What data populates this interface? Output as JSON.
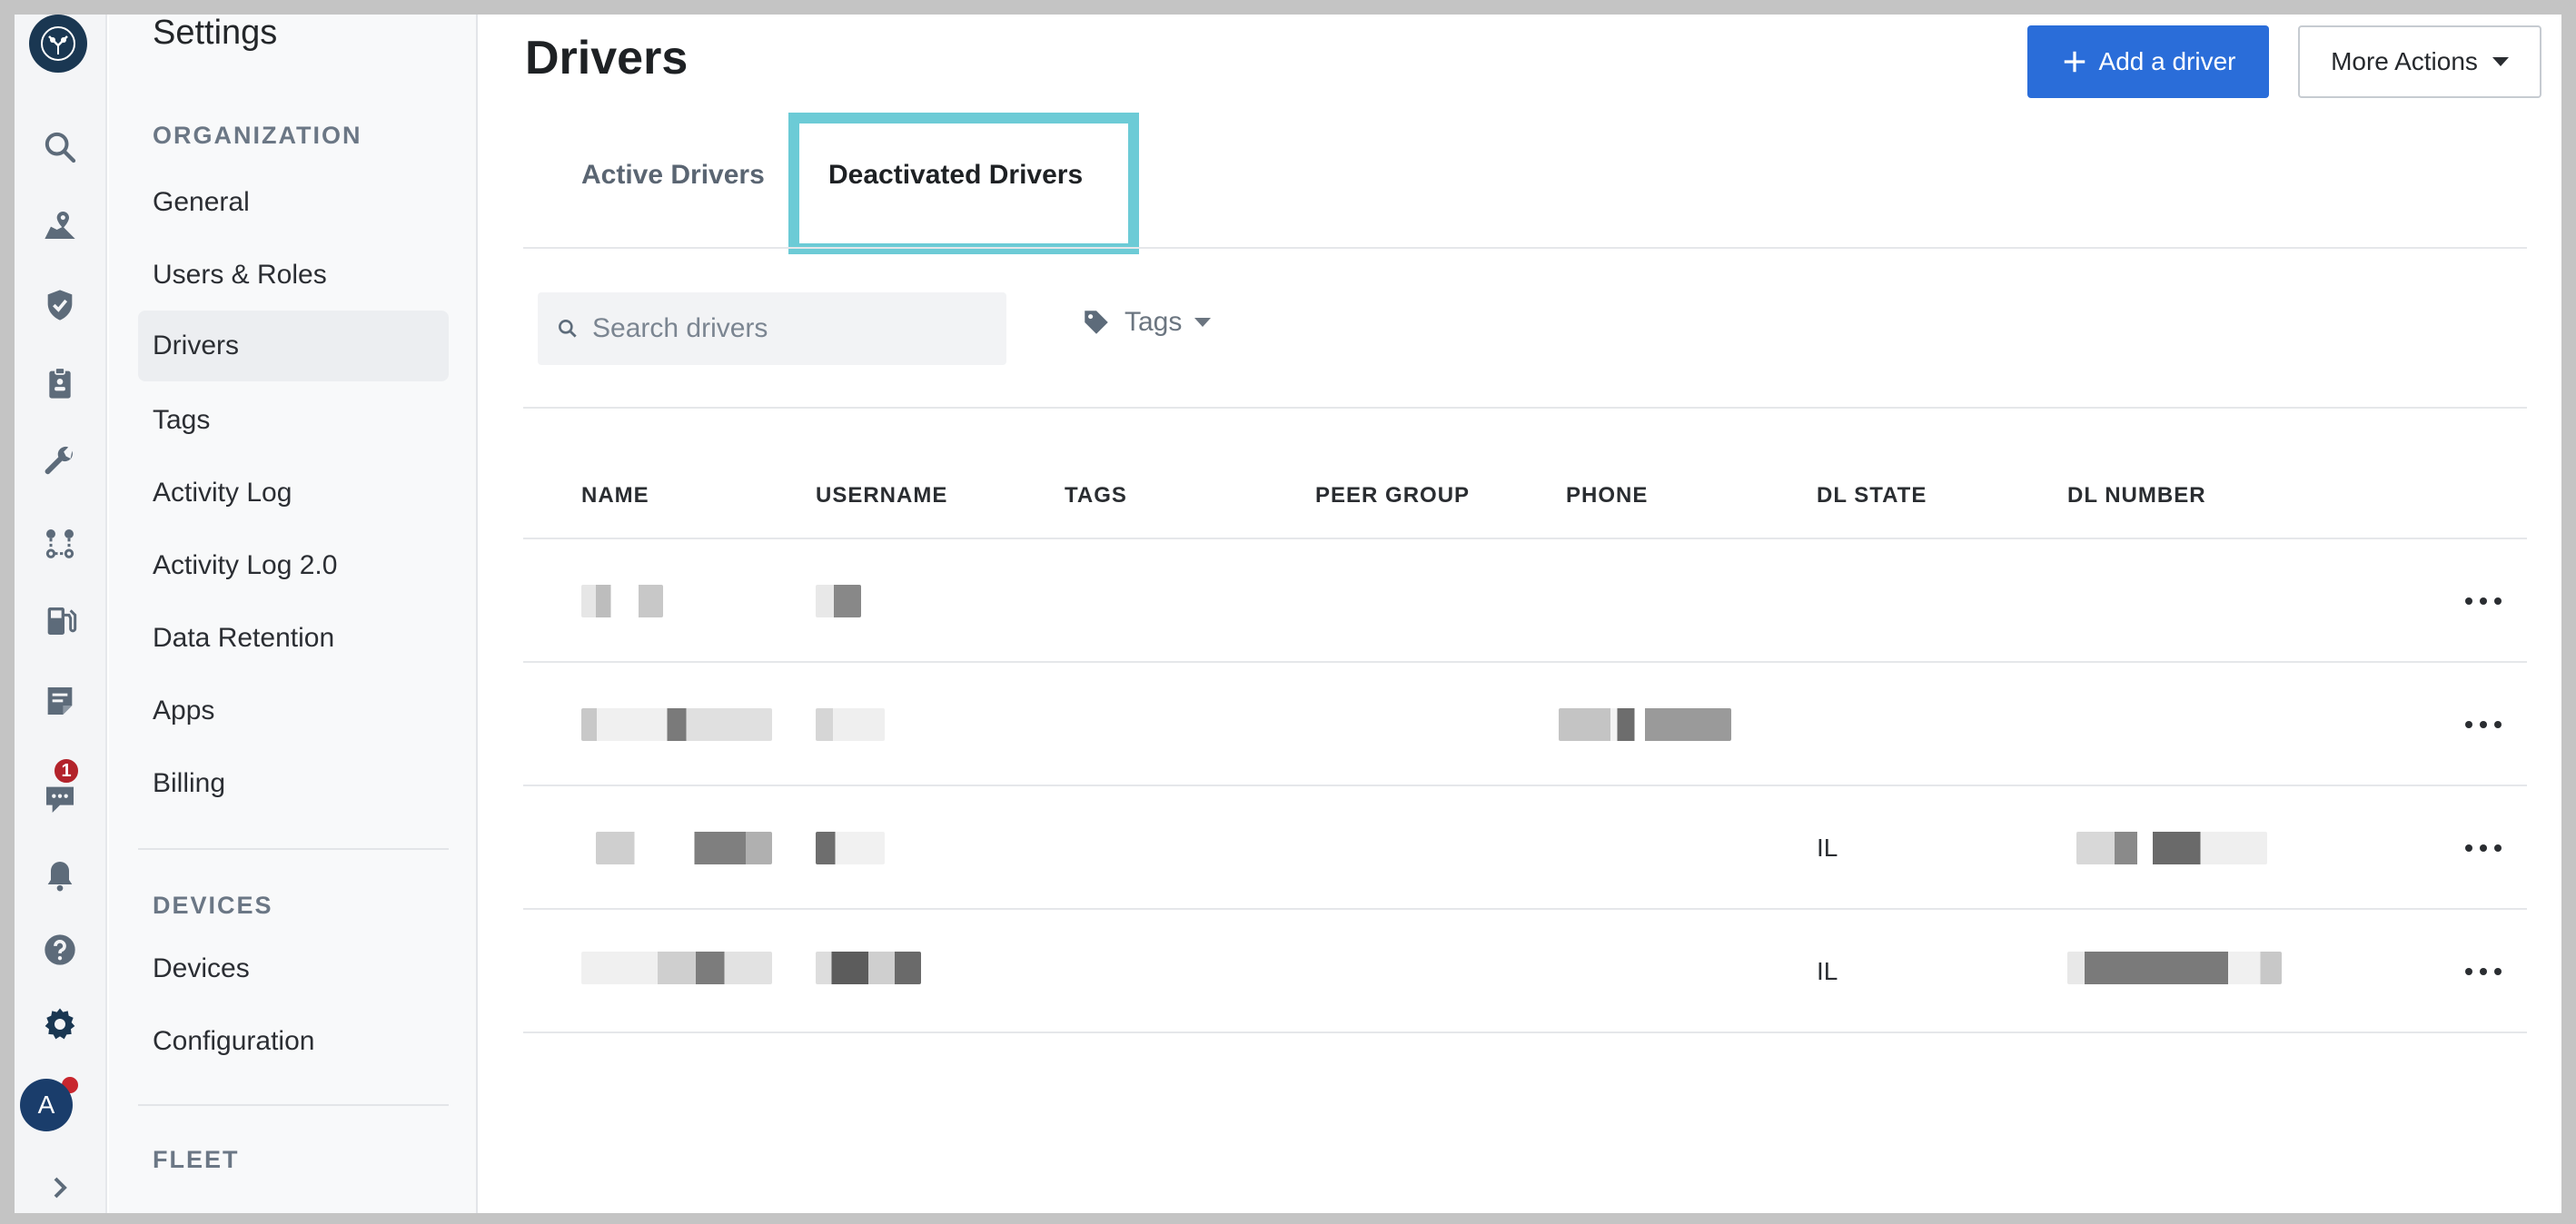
{
  "rail": {
    "icons": [
      "owl-logo-icon",
      "search-icon",
      "map-pin-icon",
      "shield-check-icon",
      "clipboard-icon",
      "wrench-icon",
      "route-icon",
      "fuel-pump-icon",
      "document-icon",
      "chat-icon",
      "bell-icon",
      "help-icon",
      "settings-gear-icon",
      "expand-chevron-icon"
    ],
    "chat_badge": "1",
    "avatar_initial": "A"
  },
  "sidebar": {
    "title": "Settings",
    "sections": [
      {
        "heading": "ORGANIZATION",
        "items": [
          "General",
          "Users & Roles",
          "Drivers",
          "Tags",
          "Activity Log",
          "Activity Log 2.0",
          "Data Retention",
          "Apps",
          "Billing"
        ]
      },
      {
        "heading": "DEVICES",
        "items": [
          "Devices",
          "Configuration"
        ]
      },
      {
        "heading": "FLEET",
        "items": []
      }
    ],
    "active_item": "Drivers"
  },
  "main": {
    "title": "Drivers",
    "add_button": "Add a driver",
    "more_button": "More Actions",
    "tabs": [
      {
        "label": "Active Drivers",
        "active": false
      },
      {
        "label": "Deactivated Drivers",
        "active": true
      }
    ],
    "search_placeholder": "Search drivers",
    "tags_filter": "Tags",
    "table": {
      "columns": [
        "NAME",
        "USERNAME",
        "TAGS",
        "PEER GROUP",
        "PHONE",
        "DL STATE",
        "DL NUMBER"
      ],
      "rows": [
        {
          "dl_state": ""
        },
        {
          "dl_state": ""
        },
        {
          "dl_state": "IL"
        },
        {
          "dl_state": "IL"
        }
      ]
    }
  },
  "colors": {
    "primary": "#2a6dd9",
    "tab_highlight": "#6ccbd6",
    "badge": "#b3232b",
    "rail_icon": "#5d6b7a",
    "active_rail_icon": "#1a3752"
  }
}
